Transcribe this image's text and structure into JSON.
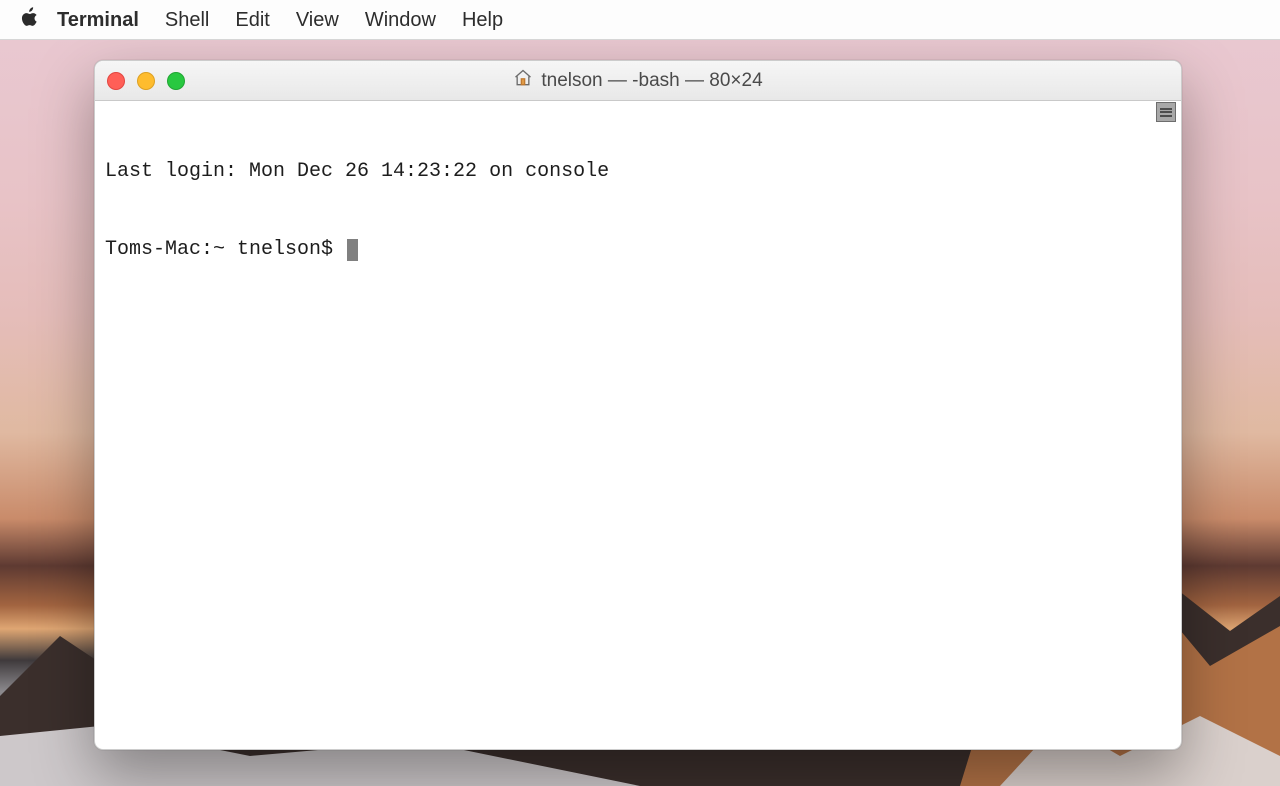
{
  "menubar": {
    "app_name": "Terminal",
    "items": [
      "Shell",
      "Edit",
      "View",
      "Window",
      "Help"
    ]
  },
  "window": {
    "title": "tnelson — -bash — 80×24",
    "traffic_icons": {
      "close": "close-icon",
      "minimize": "minimize-icon",
      "zoom": "zoom-icon"
    },
    "home_icon": "home-icon"
  },
  "terminal": {
    "last_login_line": "Last login: Mon Dec 26 14:23:22 on console",
    "prompt": "Toms-Mac:~ tnelson$ "
  }
}
